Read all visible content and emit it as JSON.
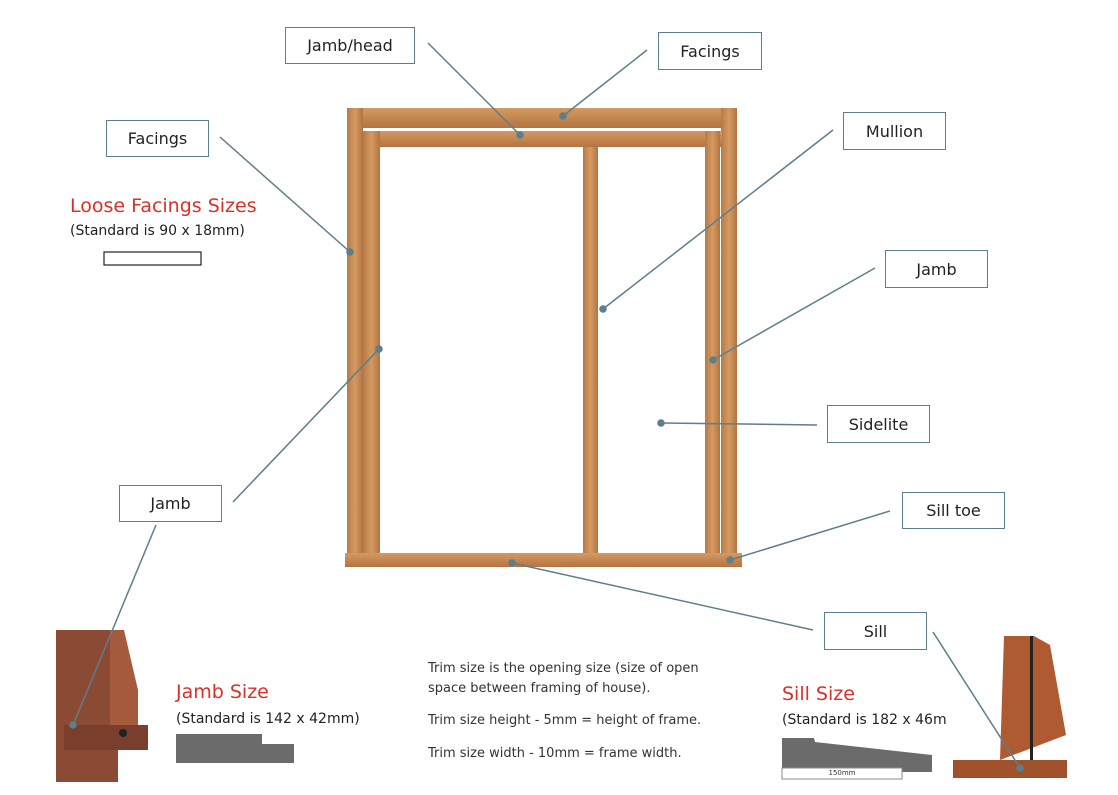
{
  "labels": {
    "jamb_head": "Jamb/head",
    "facings_top": "Facings",
    "facings_left": "Facings",
    "mullion": "Mullion",
    "jamb_right": "Jamb",
    "sidelite": "Sidelite",
    "sill_toe": "Sill toe",
    "jamb_left": "Jamb",
    "sill": "Sill"
  },
  "loose_facings": {
    "title": "Loose Facings Sizes",
    "standard": "(Standard is 90 x 18mm)"
  },
  "jamb_size": {
    "title": "Jamb Size",
    "standard": "(Standard is 142 x 42mm)"
  },
  "sill_size": {
    "title": "Sill Size",
    "standard": "(Standard is 182 x 46m",
    "profile_label": "150mm"
  },
  "notes": [
    "Trim size is the opening size (size of open space between framing of house).",
    "Trim size height - 5mm = height of frame.",
    "Trim size width - 10mm = frame width."
  ],
  "colors": {
    "wood": "#c9884f",
    "heading": "#d9302a",
    "leader": "#5d7e8c",
    "profile": "#6b6b6b"
  }
}
